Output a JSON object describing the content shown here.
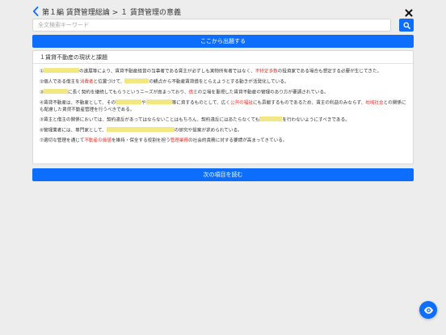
{
  "header": {
    "title": "第１編 賃貸管理総論 > １ 賃貸管理の意義"
  },
  "search": {
    "placeholder": "全文検索キーワード"
  },
  "buttons": {
    "quiz_label": "ここから出題する",
    "next_label": "次の項目を読む"
  },
  "card": {
    "title": "１賃貸不動産の現状と課題",
    "p1": {
      "t1": "①",
      "t2": "の進展等により、賃貸不動産経営の当事者である賃主が必ずしも実物所有者ではなく、",
      "r1": "不特定多数",
      "t3": "の投資家である場合も想定する必要が生じてきた。"
    },
    "p2": {
      "t1": "②個人である借主を",
      "r1": "消費者",
      "t2": "と位置づけて、",
      "t3": "の観点から不動産賃貸借をとらえようとする動きが活発化している。"
    },
    "p3": {
      "t1": "③",
      "t2": "に長く契約を継続してもらうというニーズが高まっており、",
      "r1": "借主",
      "t3": "の立場を重視した賃貸不動産の管理のあり方が要請されている。"
    },
    "p4": {
      "t1": "④賃貸不動産は、不動産として、その",
      "t2": "や",
      "t3": "等に資するものとして、広く",
      "r1": "公共の福祉",
      "t4": "にも貢献するものであるため、賃主の利益のみならず、",
      "r2": "地域社会",
      "t5": "との関係にも配慮した賃貸不動産管理を行うべきである。"
    },
    "p5": {
      "t1": "⑤賃主と借主の関係においては、契約違反があってはならないことはもちろん、契約違反にはあたらなくても",
      "t2": "を行わないようにすべきである。"
    },
    "p6": {
      "t1": "⑥管理業者には、専門家として、",
      "t2": "の研究や提案が求められている。"
    },
    "p7": {
      "t1": "⑦適切な管理を通じて",
      "r1": "不動産の価値",
      "t2": "を維持・保全する役割を担う",
      "r2": "管理業務",
      "t3": "の社会的責務に対する要請が高まってきている。"
    }
  },
  "colors": {
    "primary": "#0d6efd",
    "highlight": "#f3e784",
    "keyword_red": "#e8332a"
  },
  "icons": {
    "back": "chevron-left-icon",
    "close": "close-icon",
    "search": "search-icon",
    "eye": "eye-icon"
  }
}
